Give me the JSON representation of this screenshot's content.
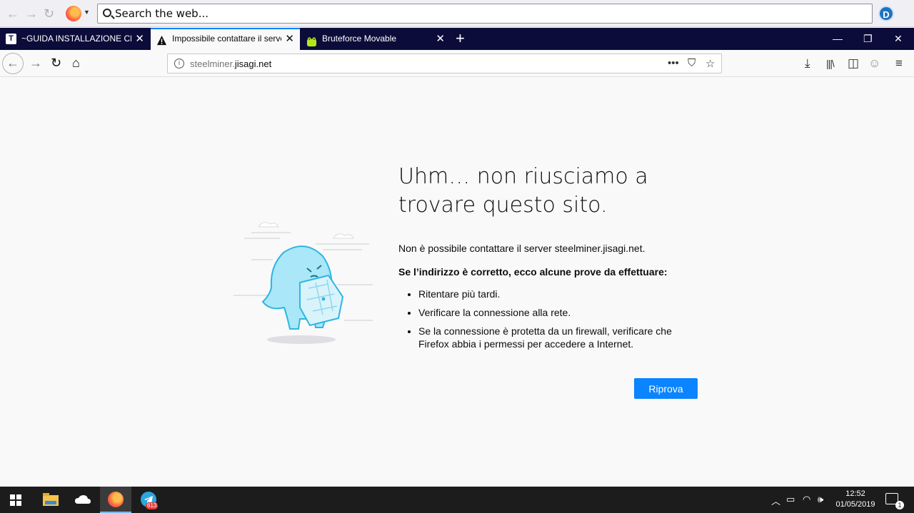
{
  "search": {
    "placeholder": "Search the web..."
  },
  "profile": {
    "initial": "D"
  },
  "tabs": [
    {
      "title": "~GUIDA INSTALLAZIONE CFW",
      "icon": "t-favicon"
    },
    {
      "title": "Impossibile contattare il server",
      "icon": "warning-icon"
    },
    {
      "title": "Bruteforce Movable",
      "icon": "frog-favicon"
    }
  ],
  "urlbar": {
    "domain_muted": "steelminer.",
    "domain": "jisagi.net"
  },
  "error": {
    "title": "Uhm… non riusciamo a trovare questo sito.",
    "description": "Non è possibile contattare il server steelminer.jisagi.net.",
    "subheading": "Se l’indirizzo è corretto, ecco alcune prove da effettuare:",
    "tips": [
      "Ritentare più tardi.",
      "Verificare la connessione alla rete.",
      "Se la connessione è protetta da un firewall, verificare che Firefox abbia i permessi per accedere a Internet."
    ],
    "retry_label": "Riprova"
  },
  "taskbar": {
    "telegram_badge": "613",
    "time": "12:52",
    "date": "01/05/2019",
    "notifications": "1"
  },
  "colors": {
    "accent": "#0a84ff",
    "tabstrip": "#0c0c3b",
    "taskbar": "#1c1c1c"
  }
}
